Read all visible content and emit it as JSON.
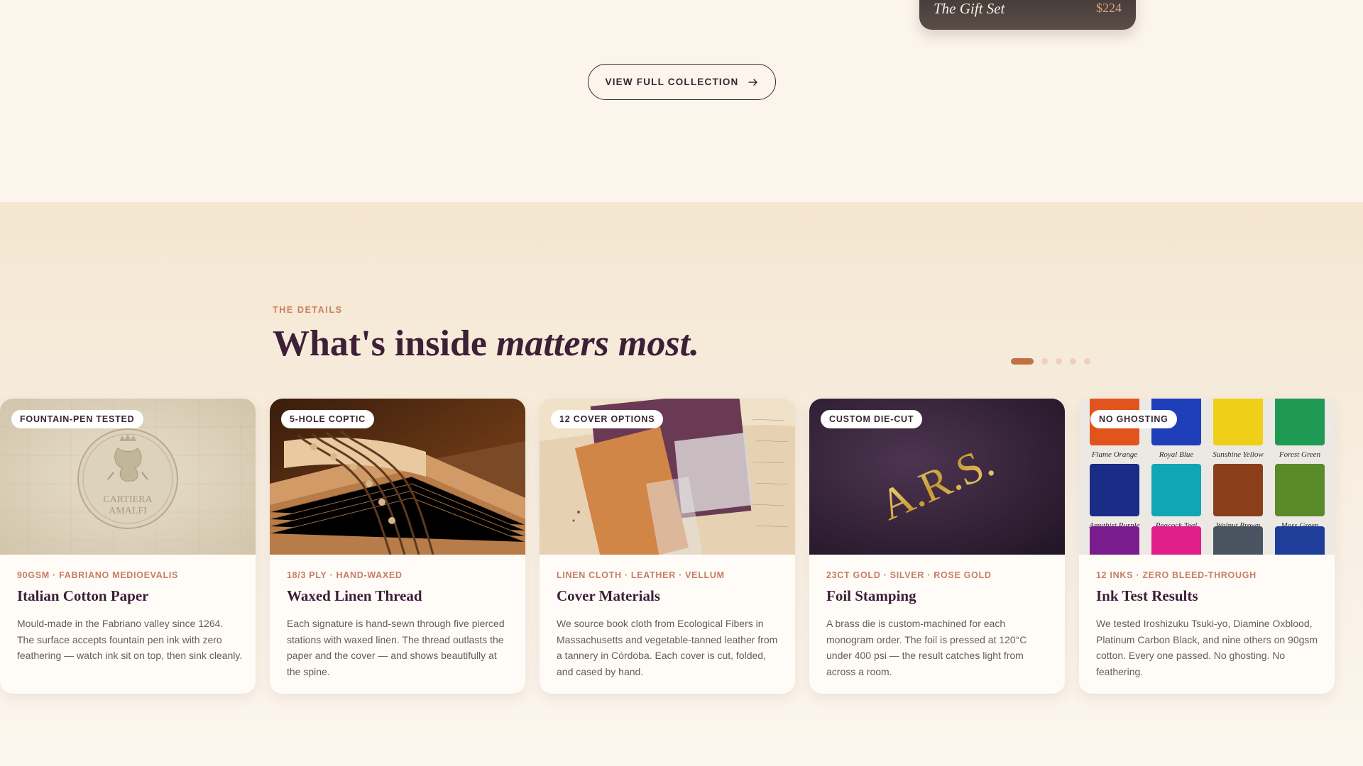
{
  "gift_set": {
    "title": "The Gift Set",
    "price": "$224"
  },
  "collection_button": {
    "label": "VIEW FULL COLLECTION",
    "icon": "arrow-right-icon"
  },
  "details": {
    "eyebrow": "THE DETAILS",
    "heading_plain": "What's inside ",
    "heading_italic": "matters most.",
    "pagination": {
      "total": 5,
      "active_index": 0
    },
    "cards": [
      {
        "badge": "FOUNTAIN-PEN TESTED",
        "meta": "90GSM · FABRIANO MEDIOEVALIS",
        "title": "Italian Cotton Paper",
        "description": "Mould-made in the Fabriano valley since 1264. The surface accepts fountain pen ink with zero feathering — watch ink sit on top, then sink cleanly.",
        "image": {
          "subject": "embossed paper seal",
          "seal_line1": "CARTIERA",
          "seal_line2": "AMALFI"
        }
      },
      {
        "badge": "5-HOLE COPTIC",
        "meta": "18/3 PLY · HAND-WAXED",
        "title": "Waxed Linen Thread",
        "description": "Each signature is hand-sewn through five pierced stations with waxed linen. The thread outlasts the paper and the cover — and shows beautifully at the spine.",
        "image": {
          "subject": "coptic stitched book spine"
        }
      },
      {
        "badge": "12 COVER OPTIONS",
        "meta": "LINEN CLOTH · LEATHER · VELLUM",
        "title": "Cover Materials",
        "description": "We source book cloth from Ecological Fibers in Massachusetts and vegetable-tanned leather from a tannery in Córdoba. Each cover is cut, folded, and cased by hand.",
        "image": {
          "subject": "cover material swatches"
        }
      },
      {
        "badge": "CUSTOM DIE-CUT",
        "meta": "23CT GOLD · SILVER · ROSE GOLD",
        "title": "Foil Stamping",
        "description": "A brass die is custom-machined for each monogram order. The foil is pressed at 120°C under 400 psi — the result catches light from across a room.",
        "image": {
          "subject": "gold foil monogram",
          "monogram": "A.R.S."
        }
      },
      {
        "badge": "NO GHOSTING",
        "meta": "12 INKS · ZERO BLEED-THROUGH",
        "title": "Ink Test Results",
        "description": "We tested Iroshizuku Tsuki-yo, Diamine Oxblood, Platinum Carbon Black, and nine others on 90gsm cotton. Every one passed. No ghosting. No feathering.",
        "image": {
          "subject": "ink swatch test sheet",
          "swatches": [
            {
              "name": "Flame Orange",
              "color": "#e2541e"
            },
            {
              "name": "Royal Blue",
              "color": "#1e3fb8"
            },
            {
              "name": "Sunshine Yellow",
              "color": "#f0cf18"
            },
            {
              "name": "Forest Green",
              "color": "#1f9a55"
            },
            {
              "name": "Amythist Purple",
              "color": "#1a2c86"
            },
            {
              "name": "Peacock Teal",
              "color": "#11a6b4"
            },
            {
              "name": "Walnut Brown",
              "color": "#8a3e1a"
            },
            {
              "name": "Moss Green",
              "color": "#5b8a2a"
            },
            {
              "name": "",
              "color": "#7b1c8e"
            },
            {
              "name": "",
              "color": "#e01f8a"
            },
            {
              "name": "",
              "color": "#4a5360"
            },
            {
              "name": "",
              "color": "#1e3e9a"
            }
          ]
        }
      }
    ]
  },
  "colors": {
    "page_bg": "#fcf5ec",
    "section_bg": "#f4e6d0",
    "heading": "#3d1f37",
    "accent": "#c27143",
    "meta": "#c67d63"
  }
}
